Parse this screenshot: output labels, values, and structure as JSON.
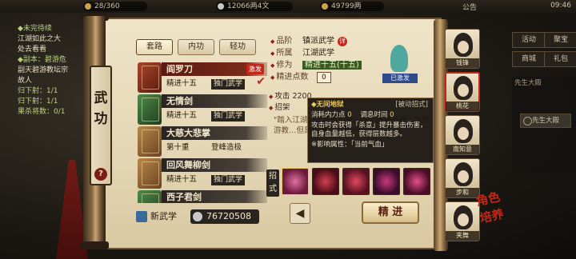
{
  "top_bar": {
    "stamina": "28/360",
    "silver": "12066两4文",
    "gold": "49799两",
    "notice": "公告",
    "clock": "09:46"
  },
  "quest_panel": {
    "lines": [
      "◆未完待续",
      "江湖如此之大",
      "处去看看",
      "◆副本：碧游危",
      "副天碧游教坛宗",
      "故人",
      "归下射：1/1",
      "归下射：1/1",
      "果杀将数：0/1"
    ]
  },
  "title_tab": {
    "char1": "武",
    "char2": "功",
    "help": "?"
  },
  "tabs": [
    {
      "label": "套路"
    },
    {
      "label": "内功"
    },
    {
      "label": "轻功"
    }
  ],
  "skills": [
    {
      "name": "阎罗刀",
      "tier": "精进十五",
      "tag": "独门武学",
      "badge": "激发",
      "checked": "✔"
    },
    {
      "name": "无情剑",
      "tier": "精进十五",
      "tag": "独门武学"
    },
    {
      "name": "大慈大悲掌",
      "tier": "第十重",
      "tag": "登峰造极"
    },
    {
      "name": "回风舞柳剑",
      "tier": "精进十五",
      "tag": "独门武学"
    },
    {
      "name": "西子君剑",
      "tier": "",
      "tag": ""
    }
  ],
  "bottom_left": {
    "new_skill": "新武学",
    "currency": "76720508"
  },
  "detail": {
    "grade_k": "品阶",
    "grade_v": "镇派武学",
    "grade_badge": "详",
    "school_k": "所属",
    "school_v": "江湖武学",
    "cult_k": "修为",
    "cult_v": "精进十五(十五)",
    "points_k": "精进点数",
    "points_v": "0",
    "figure_label": "已激发",
    "attack_k": "攻击",
    "attack_v": "2200",
    "moves_k": "招架",
    "desc": "\"踏入江湖，…步步为营…那个故事不要…为碧游教…但黑系舞…视为一种无…\""
  },
  "tooltip": {
    "title": "◆无间地狱",
    "type": "[被动招式]",
    "row1_k": "消耗内力点",
    "row1_v": "0",
    "row2_k": "调息时间",
    "row2_v": "0",
    "text": "攻击时会获得「杀意」提升暴击伤害，自身血量越低，获得层数越多。",
    "attr": "※影响属性：「当前气血」"
  },
  "moves": {
    "label": "招式"
  },
  "buttons": {
    "arrow": "◀",
    "cultivate": "精 进"
  },
  "roster": [
    {
      "name": "钱锋"
    },
    {
      "name": "桃花"
    },
    {
      "name": "南知意"
    },
    {
      "name": "步和"
    },
    {
      "name": "夹舞"
    }
  ],
  "side_menu": {
    "b1": "活动",
    "b2": "聚宝",
    "b3": "商城",
    "b4": "礼包",
    "b5": "先生大殿",
    "sys": "先生大殿",
    "calligraphy": "角色 培养"
  }
}
